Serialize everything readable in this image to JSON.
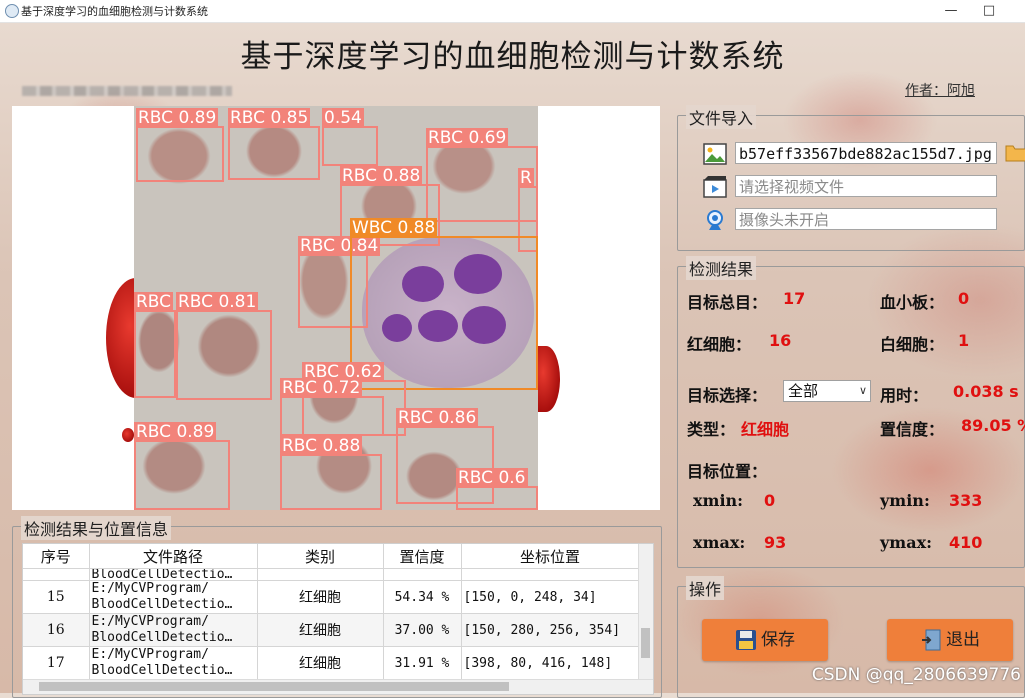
{
  "window": {
    "title": "基于深度学习的血细胞检测与计数系统",
    "min": "—",
    "max": "□"
  },
  "header": {
    "title": "基于深度学习的血细胞检测与计数系统",
    "author": "作者：阿旭"
  },
  "detections": [
    {
      "label": "RBC 0.89"
    },
    {
      "label": "RBC 0.85"
    },
    {
      "label": "0.54"
    },
    {
      "label": "RBC 0.69"
    },
    {
      "label": "RBC 0.88"
    },
    {
      "label": "R"
    },
    {
      "label": "WBC 0.88"
    },
    {
      "label": "RBC 0.84"
    },
    {
      "label": "RBC"
    },
    {
      "label": "RBC 0.81"
    },
    {
      "label": "RBC 0.62"
    },
    {
      "label": "RBC 0.72"
    },
    {
      "label": "RBC 0.86"
    },
    {
      "label": "RBC 0.89"
    },
    {
      "label": "RBC 0.88"
    },
    {
      "label": "RBC 0.6"
    }
  ],
  "file_import": {
    "title": "文件导入",
    "image_path": "b57eff33567bde882ac155d7.jpg",
    "video_placeholder": "请选择视频文件",
    "camera_status": "摄像头未开启"
  },
  "results": {
    "title": "检测结果",
    "total_label": "目标总目：",
    "total_value": "17",
    "platelet_label": "血小板：",
    "platelet_value": "0",
    "rbc_label": "红细胞：",
    "rbc_value": "16",
    "wbc_label": "白细胞：",
    "wbc_value": "1",
    "select_label": "目标选择：",
    "select_value": "全部",
    "time_label": "用时：",
    "time_value": "0.038 s",
    "type_label": "类型：",
    "type_value": "红细胞",
    "conf_label": "置信度：",
    "conf_value": "89.05 %",
    "pos_label": "目标位置：",
    "xmin_label": "xmin:",
    "xmin_value": "0",
    "ymin_label": "ymin:",
    "ymin_value": "333",
    "xmax_label": "xmax:",
    "xmax_value": "93",
    "ymax_label": "ymax:",
    "ymax_value": "410"
  },
  "operations": {
    "title": "操作",
    "save_label": "保存",
    "exit_label": "退出"
  },
  "table": {
    "title": "检测结果与位置信息",
    "headers": [
      "序号",
      "文件路径",
      "类别",
      "置信度",
      "坐标位置"
    ],
    "partial_row": {
      "path": "BloodCellDetectio…"
    },
    "rows": [
      {
        "index": "15",
        "path1": "E:/MyCVProgram/",
        "path2": "BloodCellDetectio…",
        "cls": "红细胞",
        "conf": "54.34 %",
        "coords": "[150, 0, 248, 34]"
      },
      {
        "index": "16",
        "path1": "E:/MyCVProgram/",
        "path2": "BloodCellDetectio…",
        "cls": "红细胞",
        "conf": "37.00 %",
        "coords": "[150, 280, 256, 354]"
      },
      {
        "index": "17",
        "path1": "E:/MyCVProgram/",
        "path2": "BloodCellDetectio…",
        "cls": "红细胞",
        "conf": "31.91 %",
        "coords": "[398, 80, 416, 148]"
      }
    ]
  },
  "watermark": "CSDN @qq_2806639776",
  "colors": {
    "accent_orange": "#ef7f3a",
    "value_red": "#e01010",
    "rbc_box": "#f2837a",
    "wbc_box": "#f08a27"
  }
}
